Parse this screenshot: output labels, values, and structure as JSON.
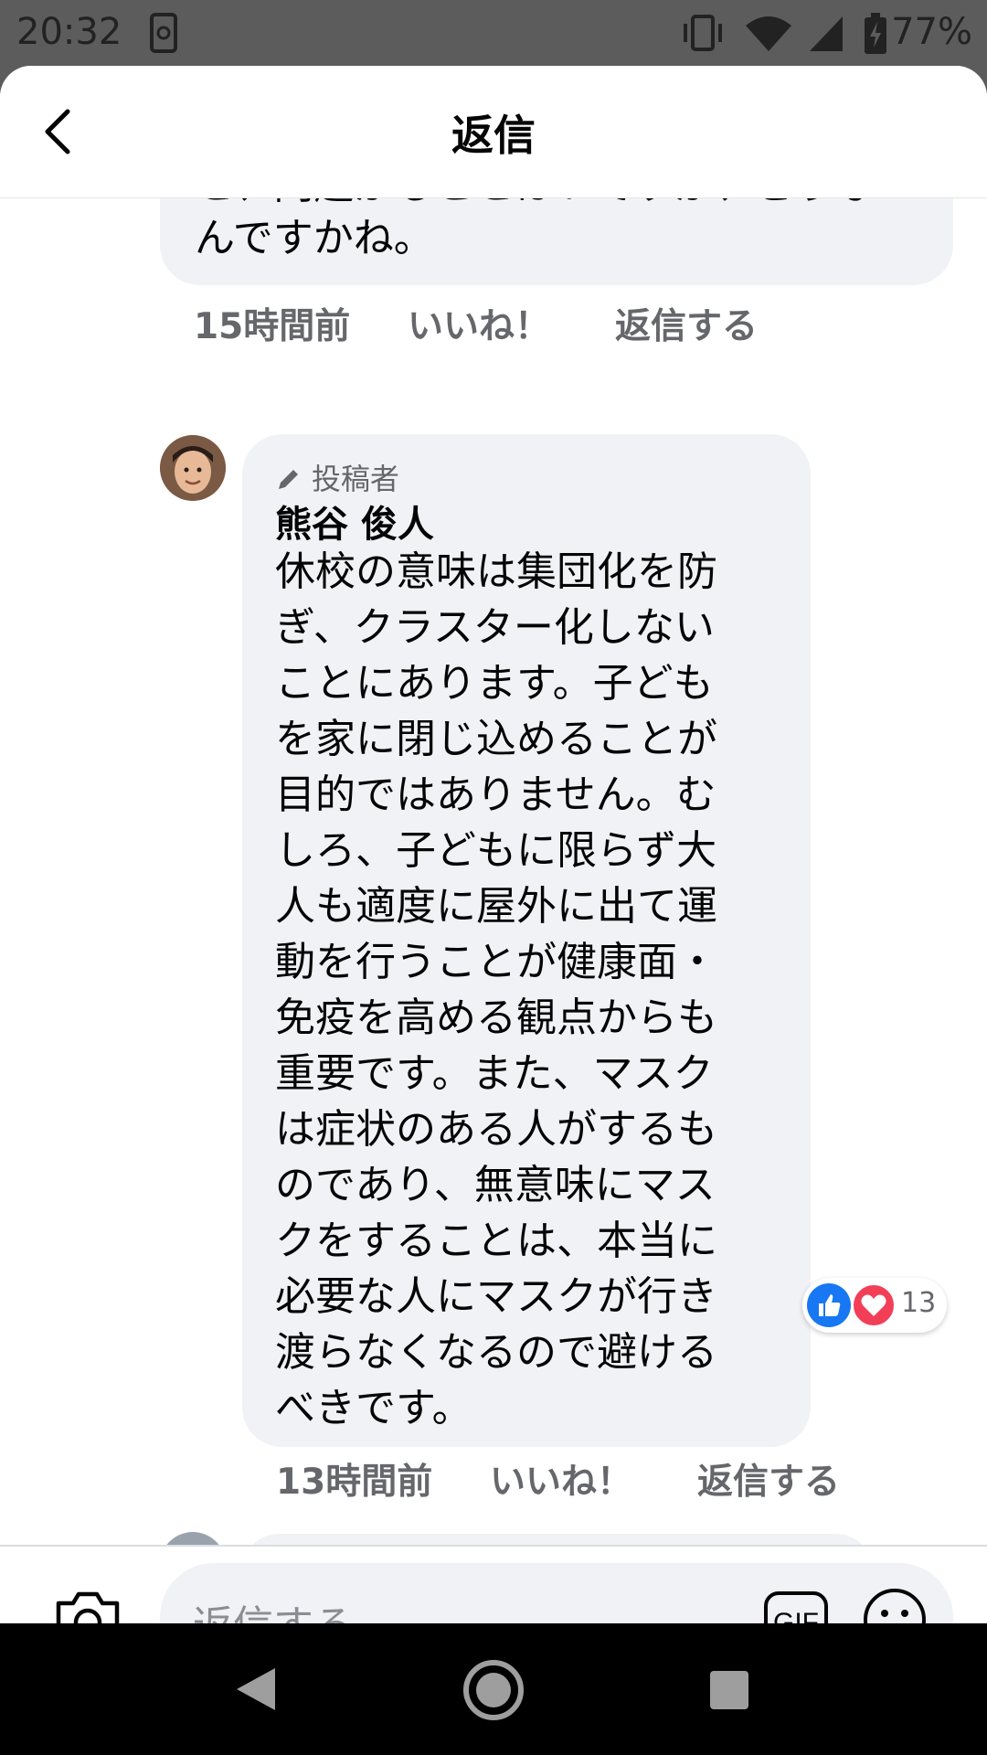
{
  "status_bar": {
    "time": "20:32",
    "battery": "77%"
  },
  "header": {
    "title": "返信"
  },
  "previous_comment": {
    "text_cut": "と、門題がることはいですが、どうな",
    "text_tail": "んですかね。",
    "time": "15時間前",
    "like": "いいね！",
    "reply": "返信する"
  },
  "comment": {
    "badge": "投稿者",
    "author": "熊谷 俊人",
    "lines": [
      "休校の意味は集団化を防",
      "ぎ、クラスター化しない",
      "ことにあります。子ども",
      "を家に閉じ込めることが",
      "目的ではありません。む",
      "しろ、子どもに限らず大",
      "人も適度に屋外に出て運",
      "動を行うことが健康面・",
      "免疫を高める観点からも",
      "重要です。また、マスク",
      "は症状のある人がするも",
      "のであり、無意味にマス",
      "クをすることは、本当に",
      "必要な人にマスクが行き",
      "渡らなくなるので避ける",
      "べきです。"
    ],
    "reaction_count": "13",
    "time": "13時間前",
    "like": "いいね！",
    "reply": "返信する"
  },
  "composer": {
    "placeholder": "返信する",
    "gif_label": "GIF"
  },
  "colors": {
    "bubble": "#f0f2f5",
    "meta": "#65676b",
    "like_blue": "#1877f2",
    "love_red": "#f33e58"
  }
}
